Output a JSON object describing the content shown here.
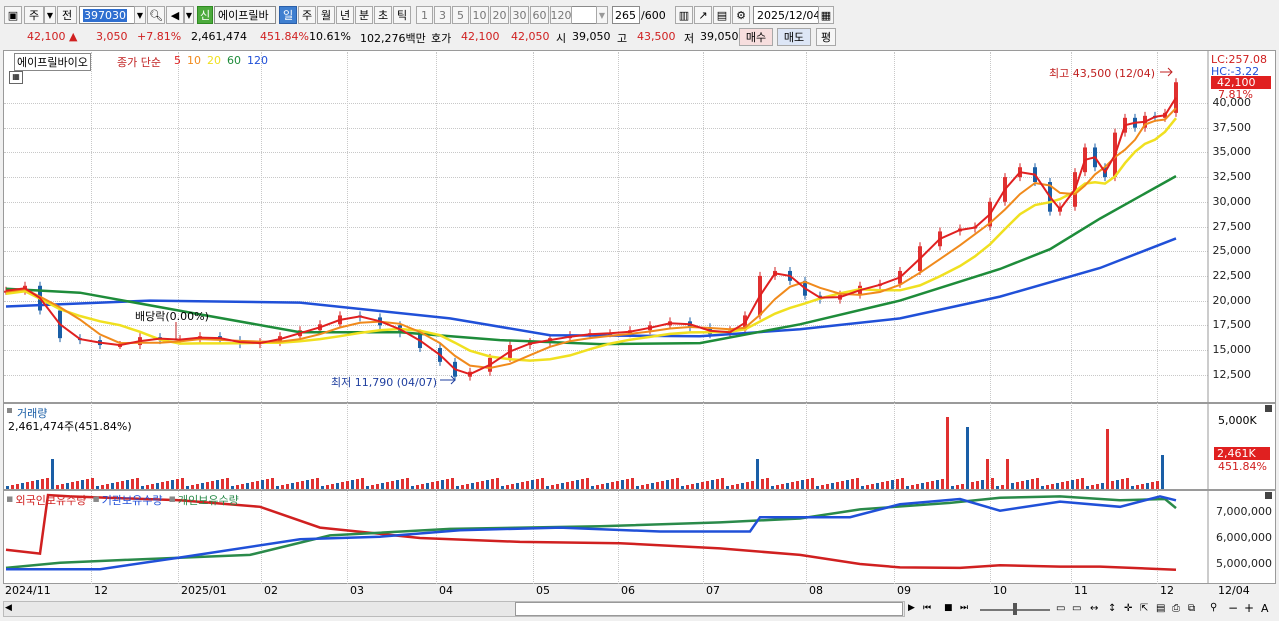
{
  "toolbar": {
    "period_type": "주",
    "compare": "전",
    "code": "397030",
    "badge": "신",
    "stock_name": "에이프릴바",
    "timeframes": [
      "일",
      "주",
      "월",
      "년",
      "분",
      "초",
      "틱"
    ],
    "timeframe_selected": "일",
    "intervals": [
      "1",
      "3",
      "5",
      "10",
      "20",
      "30",
      "60",
      "120"
    ],
    "count": "265",
    "count_total": "/600",
    "date": "2025/12/04"
  },
  "quote": {
    "price": "42,100",
    "change": "3,050",
    "change_pct": "+7.81%",
    "volume": "2,461,474",
    "volume_ratio": "451.84%",
    "turnover": "10.61%",
    "amount": "102,276백만",
    "ask_label": "호가",
    "ask": "42,100",
    "bid": "42,050",
    "open_label": "시",
    "open": "39,050",
    "high_label": "고",
    "high": "43,500",
    "low_label": "저",
    "low": "39,050",
    "buy_label": "매수",
    "sell_label": "매도",
    "eval_label": "평"
  },
  "price_panel": {
    "legend_name": "에이프릴바이오",
    "legend_ma_label": "종가 단순",
    "ma_periods": [
      "5",
      "10",
      "20",
      "60",
      "120"
    ],
    "ma_colors": [
      "#e02020",
      "#f08a1c",
      "#f0e020",
      "#1e8c3a",
      "#2050d8"
    ],
    "lc": "LC:257.08",
    "hc": "HC:-3.22",
    "last_price_tag": "42,100",
    "last_pct_tag": "7.81%",
    "y_ticks": [
      "40,000",
      "37,500",
      "35,000",
      "32,500",
      "30,000",
      "27,500",
      "25,000",
      "22,500",
      "20,000",
      "17,500",
      "15,000",
      "12,500"
    ],
    "annot_high": "최고 43,500 (12/04)",
    "annot_low": "최저 11,790 (04/07)",
    "annot_div": "배당락(0.00%)"
  },
  "volume_panel": {
    "title": "거래량",
    "value": "2,461,474주(451.84%)",
    "y_tick": "5,000K",
    "last_tag": "2,461K",
    "last_pct": "451.84%"
  },
  "holdings_panel": {
    "series": [
      "외국인보유수량",
      "기관보유수량",
      "개인보유수량"
    ],
    "series_colors": [
      "#d02020",
      "#2050d8",
      "#2a8a4a"
    ],
    "y_ticks": [
      "7,000,000",
      "6,000,000",
      "5,000,000"
    ]
  },
  "x_axis": [
    "2024/11",
    "12",
    "2025/01",
    "02",
    "03",
    "04",
    "05",
    "06",
    "07",
    "08",
    "09",
    "10",
    "11",
    "12",
    "12/04"
  ]
}
